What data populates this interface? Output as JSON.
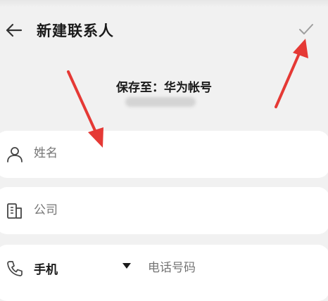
{
  "header": {
    "title": "新建联系人"
  },
  "save_to": {
    "label": "保存至：华为帐号"
  },
  "fields": {
    "name_placeholder": "姓名",
    "company_placeholder": "公司",
    "phone_type": "手机",
    "phone_placeholder": "电话号码"
  },
  "colors": {
    "background": "#f1f1f1",
    "card": "#ffffff",
    "annotation_arrow": "#e53935",
    "placeholder_text": "#8a8a8a"
  },
  "icons": {
    "back": "arrow-left-icon",
    "confirm": "check-icon",
    "name": "person-icon",
    "company": "building-icon",
    "phone": "phone-icon",
    "dropdown": "caret-down-icon"
  }
}
